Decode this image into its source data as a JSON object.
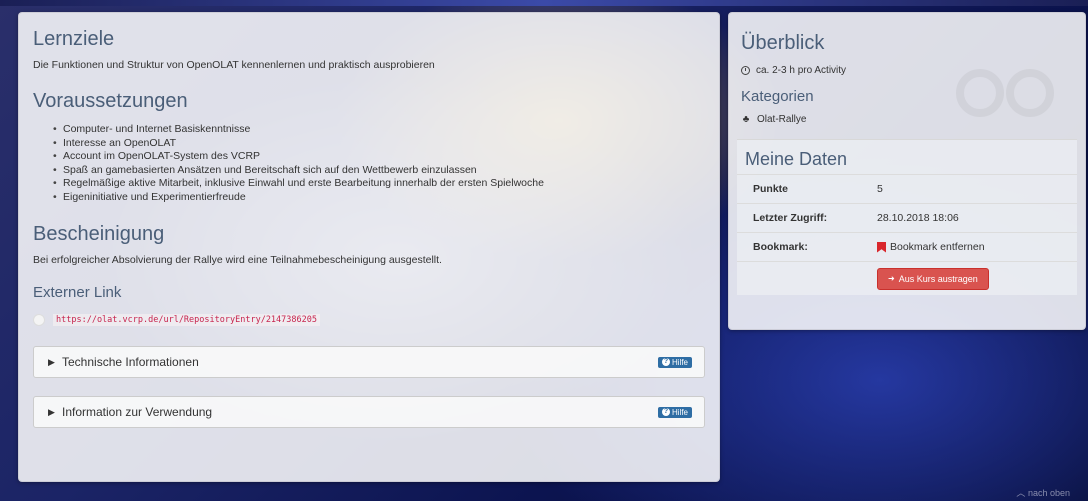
{
  "main": {
    "lernziele": {
      "title": "Lernziele",
      "text": "Die Funktionen und Struktur von OpenOLAT kennenlernen und praktisch ausprobieren"
    },
    "voraussetzungen": {
      "title": "Voraussetzungen",
      "items": [
        "Computer- und Internet Basiskenntnisse",
        "Interesse an OpenOLAT",
        "Account im OpenOLAT-System des VCRP",
        "Spaß an gamebasierten Ansätzen und Bereitschaft sich auf den Wettbewerb einzulassen",
        "Regelmäßige aktive Mitarbeit, inklusive Einwahl und erste Bearbeitung innerhalb der ersten Spielwoche",
        "Eigeninitiative und Experimentierfreude"
      ]
    },
    "bescheinigung": {
      "title": "Bescheinigung",
      "text": "Bei erfolgreicher Absolvierung der Rallye wird eine Teilnahmebescheinigung ausgestellt."
    },
    "externer_link": {
      "title": "Externer Link",
      "url": "https://olat.vcrp.de/url/RepositoryEntry/2147386205"
    },
    "panels": [
      {
        "title": "Technische Informationen",
        "help": "Hilfe"
      },
      {
        "title": "Information zur Verwendung",
        "help": "Hilfe"
      }
    ]
  },
  "side": {
    "title": "Überblick",
    "duration": "ca. 2-3 h pro Activity",
    "categories_title": "Kategorien",
    "category": "Olat-Rallye",
    "mydata": {
      "title": "Meine Daten",
      "rows": [
        {
          "label": "Punkte",
          "value": "5"
        },
        {
          "label": "Letzter Zugriff:",
          "value": "28.10.2018 18:06"
        },
        {
          "label": "Bookmark:",
          "value": "Bookmark entfernen"
        }
      ],
      "leave_button": "Aus Kurs austragen"
    }
  },
  "footer": {
    "to_top": "nach oben"
  },
  "colors": {
    "heading": "#4a5e78",
    "link": "#c7254e",
    "danger": "#d9534f",
    "bookmark": "#d9262c",
    "help": "#2e6da4"
  }
}
